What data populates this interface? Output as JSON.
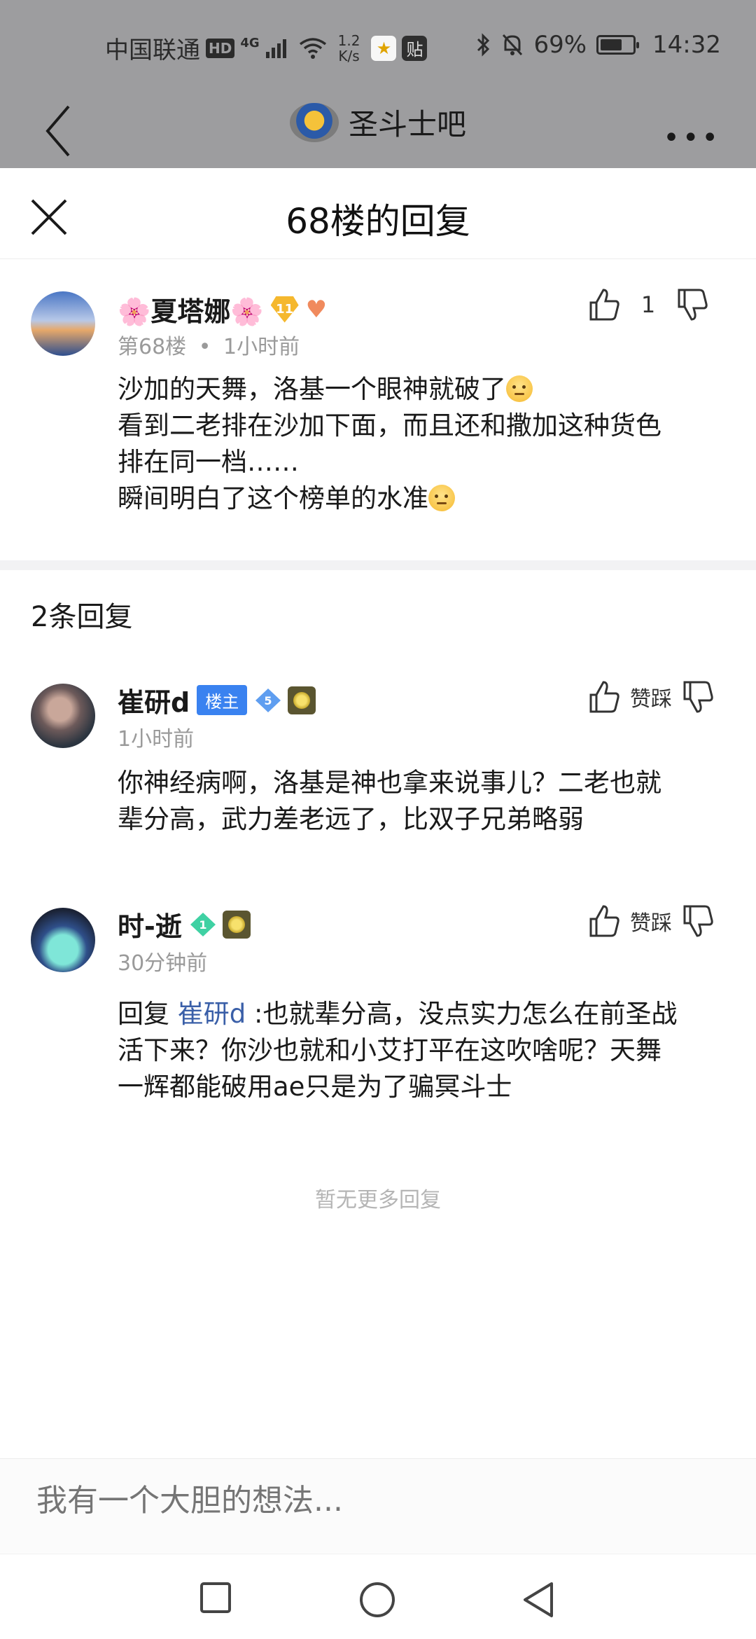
{
  "status_bar": {
    "carrier": "中国联通",
    "hd": "HD",
    "network": "4G",
    "speed_value": "1.2",
    "speed_unit": "K/s",
    "app_badge_2": "贴",
    "battery_percent": "69%",
    "battery_level": 0.69,
    "time": "14:32"
  },
  "nav": {
    "title": "圣斗士吧",
    "more": "•••"
  },
  "panel": {
    "title": "68楼的回复"
  },
  "post": {
    "username": "🌸夏塔娜🌸",
    "level": "11",
    "floor": "第68楼",
    "time": "1小时前",
    "like_count": "1",
    "lines": [
      "沙加的天舞，洛基一个眼神就破了",
      "看到二老排在沙加下面，而且还和撒加这种货色",
      "排在同一档……",
      "瞬间明白了这个榜单的水准"
    ]
  },
  "replies_header": "2条回复",
  "replies": [
    {
      "username": "崔研d",
      "host_badge": "楼主",
      "level": "5",
      "time": "1小时前",
      "vote_label": "赞踩",
      "lines": [
        "你神经病啊，洛基是神也拿来说事儿？二老也就",
        "辈分高，武力差老远了，比双子兄弟略弱"
      ]
    },
    {
      "username": "时-逝",
      "level": "1",
      "time": "30分钟前",
      "vote_label": "赞踩",
      "reply_prefix": "回复 ",
      "mention": "崔研d",
      "line1_rest": " :也就辈分高，没点实力怎么在前圣战",
      "lines_rest": [
        "活下来？你沙也就和小艾打平在这吹啥呢？天舞",
        "一辉都能破用ae只是为了骗冥斗士"
      ]
    }
  ],
  "no_more": "暂无更多回复",
  "composer": {
    "placeholder": "我有一个大胆的想法..."
  },
  "colors": {
    "dim_overlay": "#9d9d9f",
    "accent_blue": "#3a82f0",
    "mention": "#3a5fa8",
    "meta_gray": "#9a9a9a"
  }
}
